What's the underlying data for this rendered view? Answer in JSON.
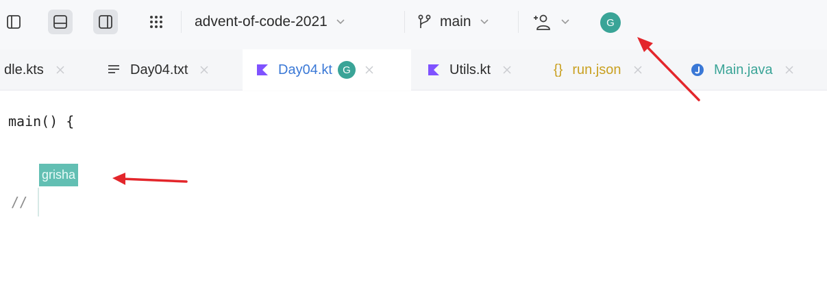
{
  "toolbar": {
    "project_name": "advent-of-code-2021",
    "branch_name": "main",
    "avatar_letter": "G"
  },
  "tabs": [
    {
      "label": "dle.kts",
      "icon": "gradle-kotlin-file-icon",
      "active": false
    },
    {
      "label": "Day04.txt",
      "icon": "text-file-icon",
      "active": false
    },
    {
      "label": "Day04.kt",
      "icon": "kotlin-icon",
      "active": true,
      "badge": "G"
    },
    {
      "label": "Utils.kt",
      "icon": "kotlin-icon",
      "active": false
    },
    {
      "label": "run.json",
      "icon": "json-braces-icon",
      "active": false
    },
    {
      "label": "Main.java",
      "icon": "java-class-icon",
      "active": false
    }
  ],
  "editor": {
    "line1": "main() {",
    "line2": "//",
    "cursor_user": "grisha"
  },
  "colors": {
    "accent_teal": "#3aa497",
    "cursor_label": "#62bfb3",
    "kotlin_purple": "#7f52ff",
    "arrow_red": "#e3262b"
  }
}
